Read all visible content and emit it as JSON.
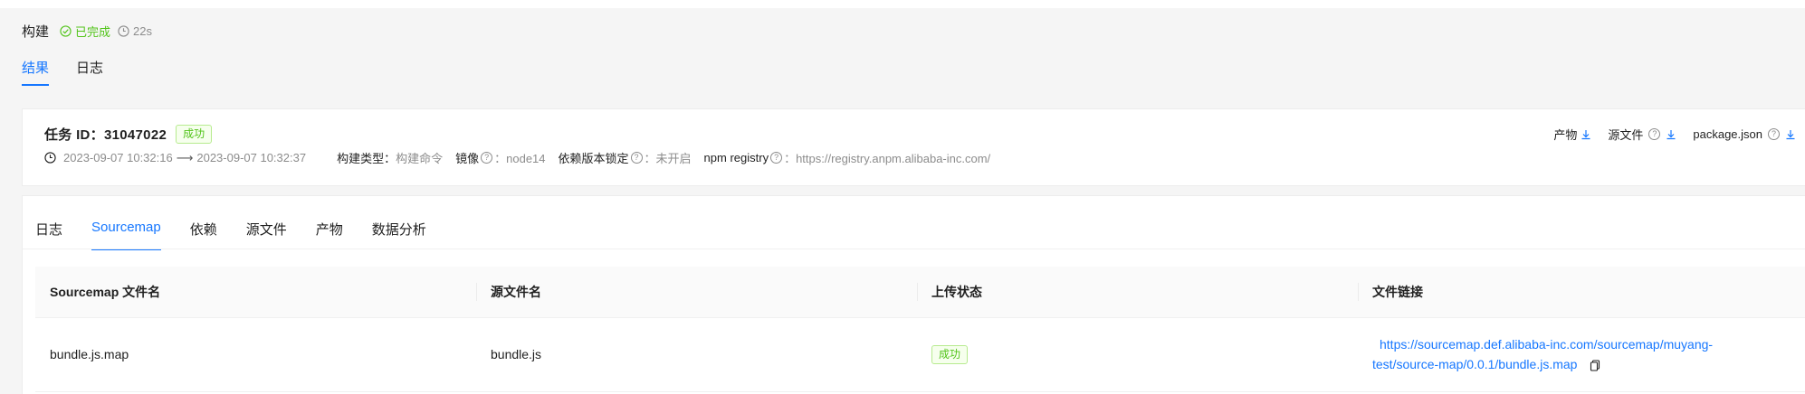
{
  "build": {
    "title": "构建",
    "status": "已完成",
    "duration": "22s"
  },
  "tabs": [
    {
      "label": "结果",
      "active": true
    },
    {
      "label": "日志",
      "active": false
    }
  ],
  "task": {
    "id_label": "任务 ID：",
    "id": "31047022",
    "status_tag": "成功",
    "start_time": "2023-09-07 10:32:16",
    "end_time": "2023-09-07 10:32:37",
    "arrow": "⟶",
    "meta": [
      {
        "key": "构建类型：",
        "value": "构建命令",
        "help": false
      },
      {
        "key": "镜像",
        "value": "：node14",
        "help": true
      },
      {
        "key": "依赖版本锁定",
        "value": "：未开启",
        "help": true
      },
      {
        "key": "npm registry",
        "value": "：https://registry.anpm.alibaba-inc.com/",
        "help": true
      }
    ],
    "downloads": [
      {
        "label": "产物",
        "help": false
      },
      {
        "label": "源文件",
        "help": true
      },
      {
        "label": "package.json",
        "help": true
      }
    ]
  },
  "subtabs": [
    {
      "label": "日志",
      "active": false
    },
    {
      "label": "Sourcemap",
      "active": true
    },
    {
      "label": "依赖",
      "active": false
    },
    {
      "label": "源文件",
      "active": false
    },
    {
      "label": "产物",
      "active": false
    },
    {
      "label": "数据分析",
      "active": false
    }
  ],
  "table": {
    "columns": [
      "Sourcemap 文件名",
      "源文件名",
      "上传状态",
      "文件链接"
    ],
    "rows": [
      {
        "sourcemap": "bundle.js.map",
        "source": "bundle.js",
        "status": "成功",
        "link_line1": "https://sourcemap.def.alibaba-inc.com/sourcemap/muyang-",
        "link_line2": "test/source-map/0.0.1/bundle.js.map"
      }
    ]
  },
  "colors": {
    "primary": "#1677ff",
    "success": "#52c41a",
    "muted": "#8c8c8c"
  }
}
